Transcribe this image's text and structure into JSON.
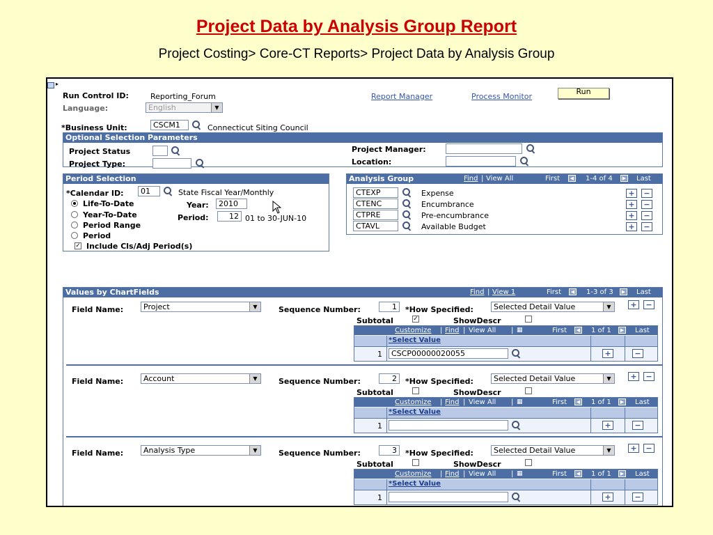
{
  "slide": {
    "title": "Project Data by Analysis Group Report",
    "subtitle": "Project Costing> Core-CT Reports> Project Data by Analysis Group"
  },
  "run_control": {
    "run_control_id_label": "Run Control ID:",
    "run_control_id_value": "Reporting_Forum",
    "language_label": "Language:",
    "language_value": "English",
    "report_manager": "Report Manager",
    "process_monitor": "Process Monitor",
    "run_button": "Run"
  },
  "business_unit": {
    "label": "*Business Unit:",
    "value": "CSCM1",
    "description": "Connecticut Siting Council"
  },
  "optional": {
    "header": "Optional Selection Parameters",
    "project_status_label": "Project Status",
    "project_type_label": "Project Type:",
    "project_manager_label": "Project Manager:",
    "location_label": "Location:"
  },
  "period": {
    "header": "Period Selection",
    "calendar_label": "*Calendar ID:",
    "calendar_value": "01",
    "calendar_desc": "State Fiscal Year/Monthly",
    "ltd": "Life-To-Date",
    "ytd": "Year-To-Date",
    "range": "Period Range",
    "period": "Period",
    "year_label": "Year:",
    "year_value": "2010",
    "period_label": "Period:",
    "period_value": "12",
    "period_desc": "01 to 30-JUN-10",
    "include_label": "Include Cls/Adj Period(s)"
  },
  "analysis_group": {
    "header": "Analysis Group",
    "find": "Find",
    "view_all": "View All",
    "first": "First",
    "count": "1-4 of 4",
    "last": "Last",
    "rows": [
      {
        "code": "CTEXP",
        "desc": "Expense"
      },
      {
        "code": "CTENC",
        "desc": "Encumbrance"
      },
      {
        "code": "CTPRE",
        "desc": "Pre-encumbrance"
      },
      {
        "code": "CTAVL",
        "desc": "Available Budget"
      }
    ]
  },
  "values": {
    "header": "Values by ChartFields",
    "find": "Find",
    "view": "View 1",
    "first": "First",
    "count": "1-3 of 3",
    "last": "Last",
    "field_name_label": "Field Name:",
    "sequence_label": "Sequence Number:",
    "how_label": "*How Specified:",
    "subtotal_label": "Subtotal",
    "showdescr_label": "ShowDescr",
    "grid_customize": "Customize",
    "grid_find": "Find",
    "grid_view_all": "View All",
    "grid_first": "First",
    "grid_count": "1 of 1",
    "grid_last": "Last",
    "grid_col": "*Select Value",
    "rows": [
      {
        "field": "Project",
        "seq": "1",
        "how": "Selected Detail Value",
        "subtotal": true,
        "showdescr": false,
        "row_no": "1",
        "value": "CSCP00000020055"
      },
      {
        "field": "Account",
        "seq": "2",
        "how": "Selected Detail Value",
        "subtotal": false,
        "showdescr": false,
        "row_no": "1",
        "value": ""
      },
      {
        "field": "Analysis Type",
        "seq": "3",
        "how": "Selected Detail Value",
        "subtotal": false,
        "showdescr": false,
        "row_no": "1",
        "value": ""
      }
    ]
  }
}
